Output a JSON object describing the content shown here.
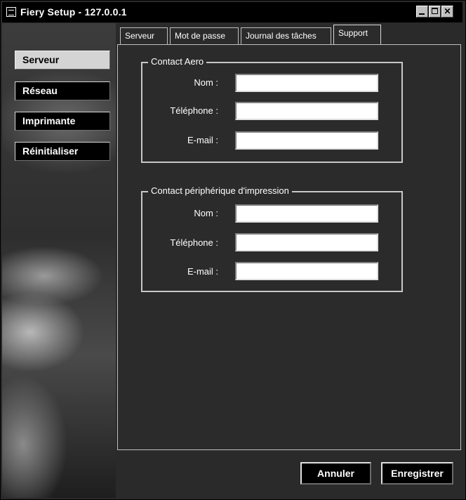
{
  "window": {
    "title": "Fiery Setup - 127.0.0.1",
    "controls": {
      "minimize": "minimize",
      "maximize": "maximize",
      "close": "close"
    }
  },
  "sidebar": {
    "items": [
      {
        "label": "Serveur",
        "active": true
      },
      {
        "label": "Réseau",
        "active": false
      },
      {
        "label": "Imprimante",
        "active": false
      },
      {
        "label": "Réinitialiser",
        "active": false
      }
    ]
  },
  "tabs": [
    {
      "label": "Serveur",
      "active": false
    },
    {
      "label": "Mot de passe",
      "active": false
    },
    {
      "label": "Journal des tâches",
      "active": false
    },
    {
      "label": "Support",
      "active": true
    }
  ],
  "groups": {
    "aero": {
      "title": "Contact Aero",
      "name_label": "Nom :",
      "name_value": "",
      "phone_label": "Téléphone :",
      "phone_value": "",
      "email_label": "E-mail :",
      "email_value": ""
    },
    "device": {
      "title": "Contact périphérique d'impression",
      "name_label": "Nom :",
      "name_value": "",
      "phone_label": "Téléphone :",
      "phone_value": "",
      "email_label": "E-mail :",
      "email_value": ""
    }
  },
  "actions": {
    "cancel": "Annuler",
    "save": "Enregistrer"
  },
  "icons": {
    "app": "app-window-icon",
    "minimize": "minimize-icon",
    "maximize": "maximize-icon",
    "close": "close-icon"
  },
  "colors": {
    "background": "#2b2b2b",
    "title_bar": "#000000",
    "active_nav": "#d4d4d4",
    "field": "#ffffff"
  }
}
